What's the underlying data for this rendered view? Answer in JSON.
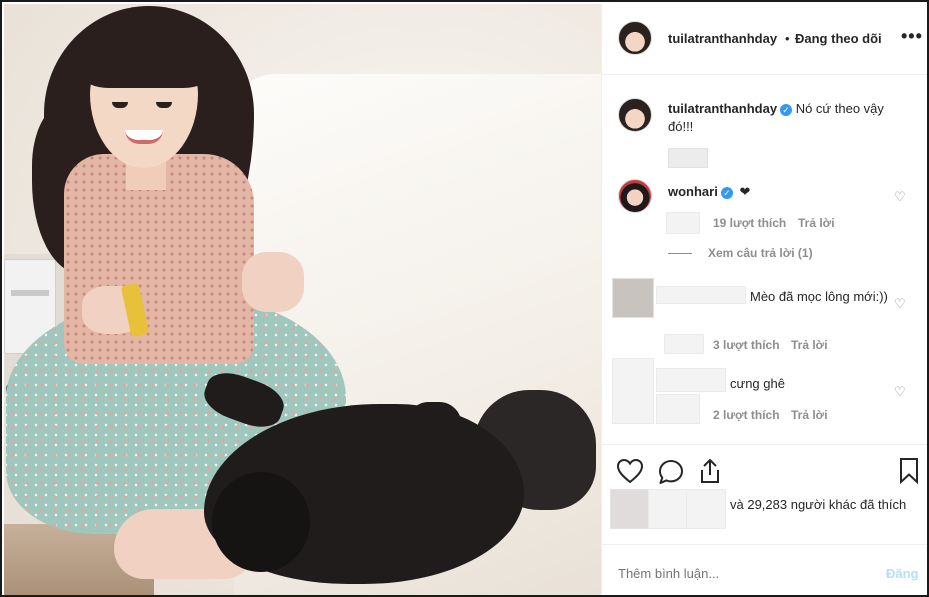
{
  "post": {
    "author": "tuilatranthanhday",
    "follow_status": "Đang theo dõi",
    "separator": "•",
    "more": "•••"
  },
  "caption": {
    "username": "tuilatranthanhday",
    "text": "Nó cứ theo vậy đó!!!",
    "verified": true
  },
  "comments": [
    {
      "username": "wonhari",
      "verified": true,
      "text": "❤",
      "likes": "19 lượt thích",
      "reply_label": "Trả lời",
      "view_replies": "Xem câu trả lời (1)"
    },
    {
      "username": "",
      "text": "Mèo đã mọc lông mới:))",
      "likes": "3 lượt thích",
      "reply_label": "Trả lời"
    },
    {
      "username": "",
      "text": "cưng ghê",
      "likes": "2 lượt thích",
      "reply_label": "Trả lời"
    }
  ],
  "engagement": {
    "likes_text": "và 29,283 người khác đã thích"
  },
  "composer": {
    "placeholder": "Thêm bình luận...",
    "post_label": "Đăng"
  },
  "icons": {
    "like": "heart-icon",
    "comment": "comment-bubble-icon",
    "share": "share-icon",
    "save": "bookmark-icon",
    "comment_like": "heart-outline-small-icon"
  },
  "colors": {
    "verified": "#3897f0",
    "muted_text": "#8e8e8e",
    "post_button_disabled": "#b2dffc"
  }
}
